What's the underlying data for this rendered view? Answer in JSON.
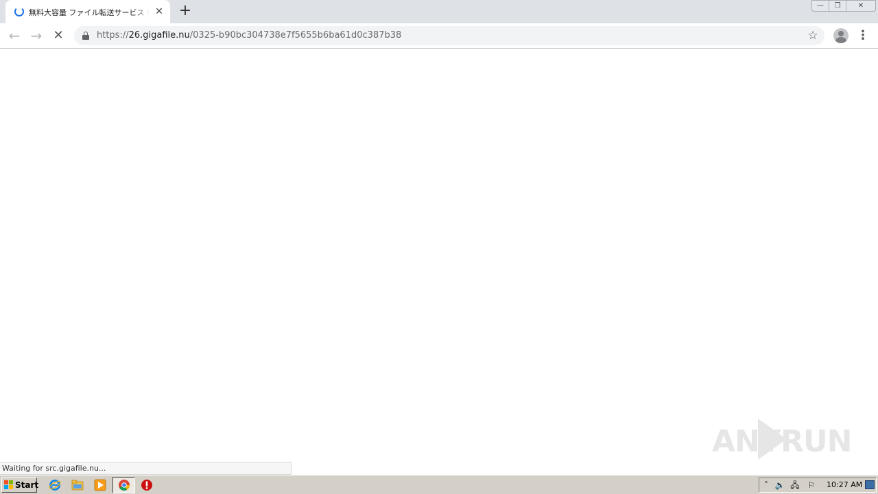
{
  "tab": {
    "title": "無料大容量 ファイル転送サービス GigaFile"
  },
  "new_tab_label": "+",
  "window_controls": {
    "minimize": "—",
    "maximize": "❐",
    "close": "✕"
  },
  "toolbar": {
    "back_icon": "←",
    "forward_icon": "→",
    "stop_icon": "✕",
    "star_icon": "☆",
    "menu_icon": "⋮"
  },
  "address_bar": {
    "scheme": "https://",
    "host": "26.gigafile.nu",
    "path": "/0325-b90bc304738e7f5655b6ba61d0c387b38"
  },
  "status_bubble": "Waiting for src.gigafile.nu...",
  "watermark": {
    "left": "ANY",
    "right": "RUN"
  },
  "taskbar": {
    "start_label": "Start",
    "clock": "10:27 AM"
  },
  "colors": {
    "tab_strip": "#dee1e6",
    "spinner": "#1a73e8",
    "taskbar": "#d4d0c8"
  }
}
